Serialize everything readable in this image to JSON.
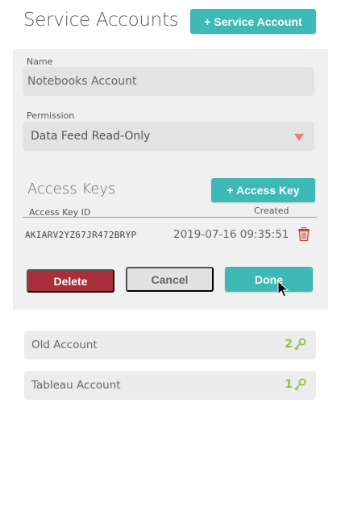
{
  "header": {
    "title": "Service Accounts",
    "add_account_label": "+ Service Account"
  },
  "editor": {
    "name_label": "Name",
    "name_value": "Notebooks Account",
    "permission_label": "Permission",
    "permission_value": "Data Feed Read-Only",
    "access_keys_title": "Access Keys",
    "add_key_label": "+ Access Key",
    "columns": {
      "key_id": "Access Key ID",
      "created": "Created"
    },
    "keys": [
      {
        "id": "AKIARV2YZ67JR472BRYP",
        "created": "2019-07-16 09:35:51"
      }
    ],
    "delete_label": "Delete",
    "cancel_label": "Cancel",
    "done_label": "Done"
  },
  "accounts": [
    {
      "name": "Old Account",
      "key_count": "2"
    },
    {
      "name": "Tableau Account",
      "key_count": "1"
    }
  ],
  "colors": {
    "teal": "#3dbab5",
    "delete_red": "#a9303a",
    "key_green": "#8bc34a",
    "caret_red": "#f07a7a"
  },
  "icons": {
    "trash": "trash-icon",
    "key": "key-icon",
    "caret": "chevron-down-icon",
    "cursor": "mouse-cursor-icon"
  }
}
